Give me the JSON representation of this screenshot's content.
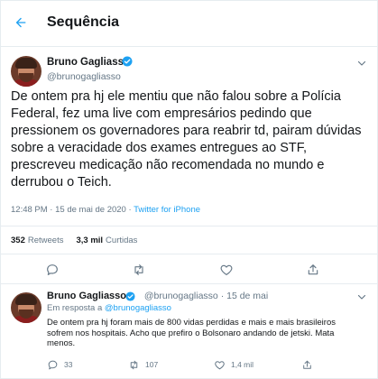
{
  "header": {
    "title": "Sequência"
  },
  "tweet": {
    "display_name": "Bruno Gagliasso",
    "handle": "@brunogagliasso",
    "text": "De ontem pra hj ele mentiu que não falou sobre a Polícia Federal, fez uma live com empresários pedindo que pressionem os governadores para reabrir td, pairam dúvidas sobre a veracidade dos exames entregues ao STF, prescreveu medicação não recomendada no mundo e derrubou o Teich.",
    "time": "12:48 PM",
    "date": "15 de mai de 2020",
    "sep": " · ",
    "source": "Twitter for iPhone",
    "retweets_count": "352",
    "retweets_label": "Retweets",
    "likes_count": "3,3 mil",
    "likes_label": "Curtidas"
  },
  "reply": {
    "display_name": "Bruno Gagliasso",
    "handle": "@brunogagliasso",
    "date": "· 15 de mai",
    "reply_prefix": "Em resposta a ",
    "reply_mention": "@brunogagliasso",
    "text": "De ontem pra hj foram mais de 800 vidas perdidas e mais e mais brasileiros sofrem nos hospitais. Acho que prefiro o Bolsonaro andando de jetski. Mata menos.",
    "replies": "33",
    "retweets": "107",
    "likes": "1,4 mil"
  },
  "icons": {
    "back": "arrow-left-icon",
    "verified": "verified-badge-icon",
    "more": "chevron-down-icon",
    "reply": "comment-icon",
    "retweet": "retweet-icon",
    "like": "heart-icon",
    "share": "share-icon"
  },
  "colors": {
    "accent": "#1da1f2",
    "text": "#14171a",
    "muted": "#657786",
    "border": "#e6ecf0"
  }
}
